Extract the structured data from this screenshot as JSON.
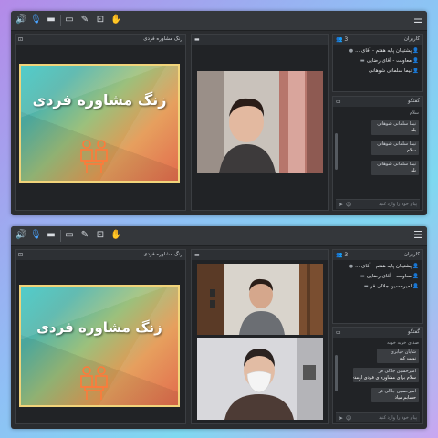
{
  "colors": {
    "frame_bg": "#2a2c2f",
    "accent": "#4aa3ff",
    "slide_border": "#f1d37a"
  },
  "toolbar_icons": [
    "audio-icon",
    "mic-icon",
    "camera-icon",
    "screen-share-icon",
    "pen-icon",
    "present-icon",
    "raise-hand-icon",
    "menu-icon"
  ],
  "shots": [
    {
      "presentation": {
        "header": "زنگ مشاوره فردی",
        "slide_title": "زنگ مشاوره فردی"
      },
      "camera": {
        "header": ""
      },
      "attendees": {
        "header": "کاربران",
        "count": "3",
        "rows": [
          {
            "name": "پشتیبان پایه هفتم - آقای ..."
          },
          {
            "name": "معاونت - آقای رضایی"
          },
          {
            "name": "نیما سلمانی شوهانی"
          }
        ]
      },
      "chat": {
        "header": "گفتگو",
        "messages": [
          {
            "who": "سلام",
            "msg": ""
          },
          {
            "who": "نیما سلمانی شوهانی",
            "msg": "بله"
          },
          {
            "who": "نیما سلمانی شوهانی",
            "msg": "سلام"
          },
          {
            "who": "نیما سلمانی شوهانی",
            "msg": "بله"
          }
        ],
        "input_placeholder": "پیام خود را وارد کنید"
      }
    },
    {
      "presentation": {
        "header": "زنگ مشاوره فردی",
        "slide_title": "زنگ مشاوره فردی"
      },
      "camera": {
        "header": ""
      },
      "attendees": {
        "header": "کاربران",
        "count": "3",
        "rows": [
          {
            "name": "پشتیبان پایه هفتم - آقای ..."
          },
          {
            "name": "معاونت - آقای رضایی"
          },
          {
            "name": "امیرحسین جلالی فر"
          }
        ]
      },
      "chat": {
        "header": "گفتگو",
        "messages": [
          {
            "who": "صدای خوبه خوبه",
            "msg": ""
          },
          {
            "who": "شایان خیابری",
            "msg": "نوبت کیه"
          },
          {
            "who": "امیرحسین جلالی فر",
            "msg": "سلام برای مشاوره ی فردی اومدم"
          },
          {
            "who": "امیرحسین جلالی فر",
            "msg": "حسابم میاد"
          }
        ],
        "input_placeholder": "پیام خود را وارد کنید"
      }
    }
  ]
}
